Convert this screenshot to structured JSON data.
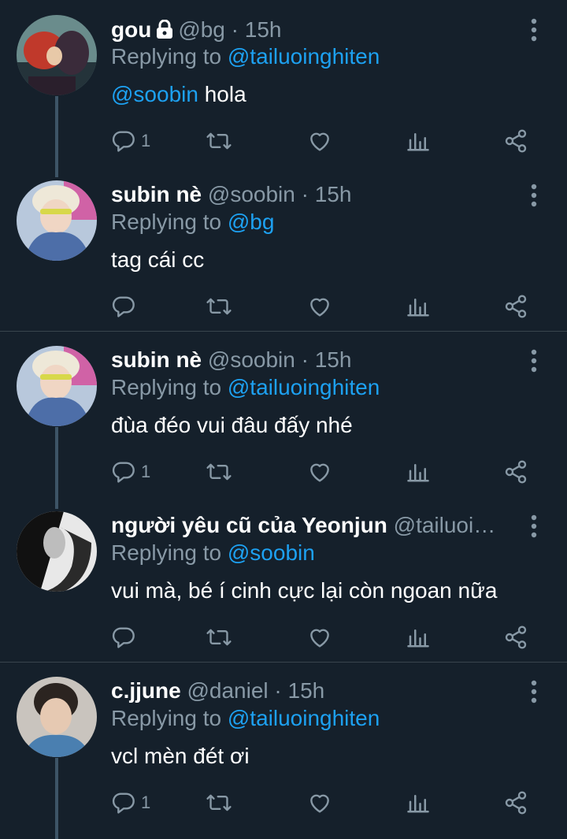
{
  "reply_prefix": "Replying to",
  "tweets": [
    {
      "name": "gou",
      "locked": true,
      "handle": "@bg",
      "dot": "·",
      "time": "15h",
      "replying_to": "@tailuoinghiten",
      "body_mention": "@soobin",
      "body_text": " hola",
      "reply_count": "1",
      "avatar_style": "cartoon"
    },
    {
      "name": "subin nè",
      "handle": "@soobin",
      "dot": "·",
      "time": "15h",
      "replying_to": "@bg",
      "body_text": "tag cái cc",
      "reply_count": "",
      "avatar_style": "blond"
    },
    {
      "name": "subin nè",
      "handle": "@soobin",
      "dot": "·",
      "time": "15h",
      "replying_to": "@tailuoinghiten",
      "body_text": "đùa đéo vui đâu đấy nhé",
      "reply_count": "1",
      "avatar_style": "blond"
    },
    {
      "name": "người yêu cũ của Yeonjun",
      "handle": "@tailuoi…",
      "replying_to": "@soobin",
      "body_text": "vui mà, bé í cinh cực lại còn ngoan nữa",
      "reply_count": "",
      "avatar_style": "bw"
    },
    {
      "name": "c.jjune",
      "handle": "@daniel",
      "dot": "·",
      "time": "15h",
      "replying_to": "@tailuoinghiten",
      "body_text": "vcl mèn đét ơi",
      "reply_count": "1",
      "avatar_style": "portrait"
    }
  ],
  "colors": {
    "background": "#15202b",
    "text": "#ffffff",
    "secondary": "#8899a6",
    "accent": "#1da1f2",
    "divider": "#38444d"
  },
  "icons": [
    "lock-icon",
    "more-vertical-icon",
    "reply-icon",
    "retweet-icon",
    "like-icon",
    "analytics-icon",
    "share-icon"
  ]
}
